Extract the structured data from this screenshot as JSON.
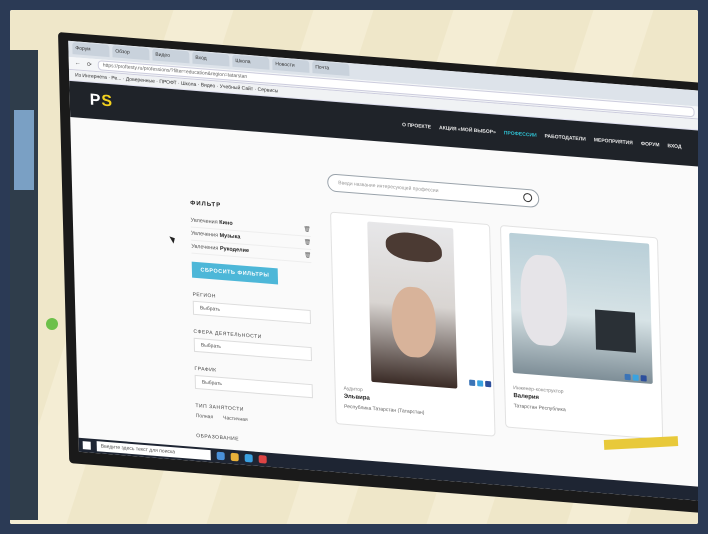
{
  "browser": {
    "tabs": [
      "Форум",
      "Обзор",
      "Видео",
      "Вход",
      "Школа",
      "Новости",
      "Почта"
    ],
    "url": "https://proftesty.ru/professions/?filter=education&region=tatarstan",
    "bookmarks": "Из Интернета · Ре... · Доверенные · ПРОФТ · Школа · Видео · Учебный Сайт · Сервисы"
  },
  "site": {
    "logo_main": "P",
    "logo_accent": "S",
    "nav": [
      "О ПРОЕКТЕ",
      "АКЦИЯ «МОЙ ВЫБОР»",
      "ПРОФЕССИИ",
      "РАБОТОДАТЕЛИ",
      "МЕРОПРИЯТИЯ",
      "ФОРУМ",
      "ВХОД"
    ],
    "search_placeholder": "Введи название интересующей профессии"
  },
  "filter": {
    "title": "ФИЛЬТР",
    "chips": [
      {
        "prefix": "Увлечения",
        "value": "Кино"
      },
      {
        "prefix": "Увлечения",
        "value": "Музыка"
      },
      {
        "prefix": "Увлечения",
        "value": "Рукоделие"
      }
    ],
    "reset_label": "СБРОСИТЬ ФИЛЬТРЫ",
    "region_label": "РЕГИОН",
    "region_value": "Выбрать",
    "sphere_label": "СФЕРА ДЕЯТЕЛЬНОСТИ",
    "sphere_value": "Выбрать",
    "schedule_label": "ГРАФИК",
    "schedule_value": "Выбрать",
    "employment_label": "ТИП ЗАНЯТОСТИ",
    "employment_full": "Полная",
    "employment_part": "Частичная",
    "extra_label": "ОБРАЗОВАНИЕ"
  },
  "cards": [
    {
      "role": "Аудитор",
      "name": "Эльвира",
      "region": "Республика Татарстан (Татарстан)"
    },
    {
      "role": "Инженер-конструктор",
      "name": "Валерия",
      "region": "Татарстан Республика"
    }
  ],
  "taskbar": {
    "search": "Введите здесь текст для поиска"
  },
  "colors": {
    "accent": "#4db7d8",
    "logo": "#f4d21f",
    "header": "#1f2329"
  }
}
